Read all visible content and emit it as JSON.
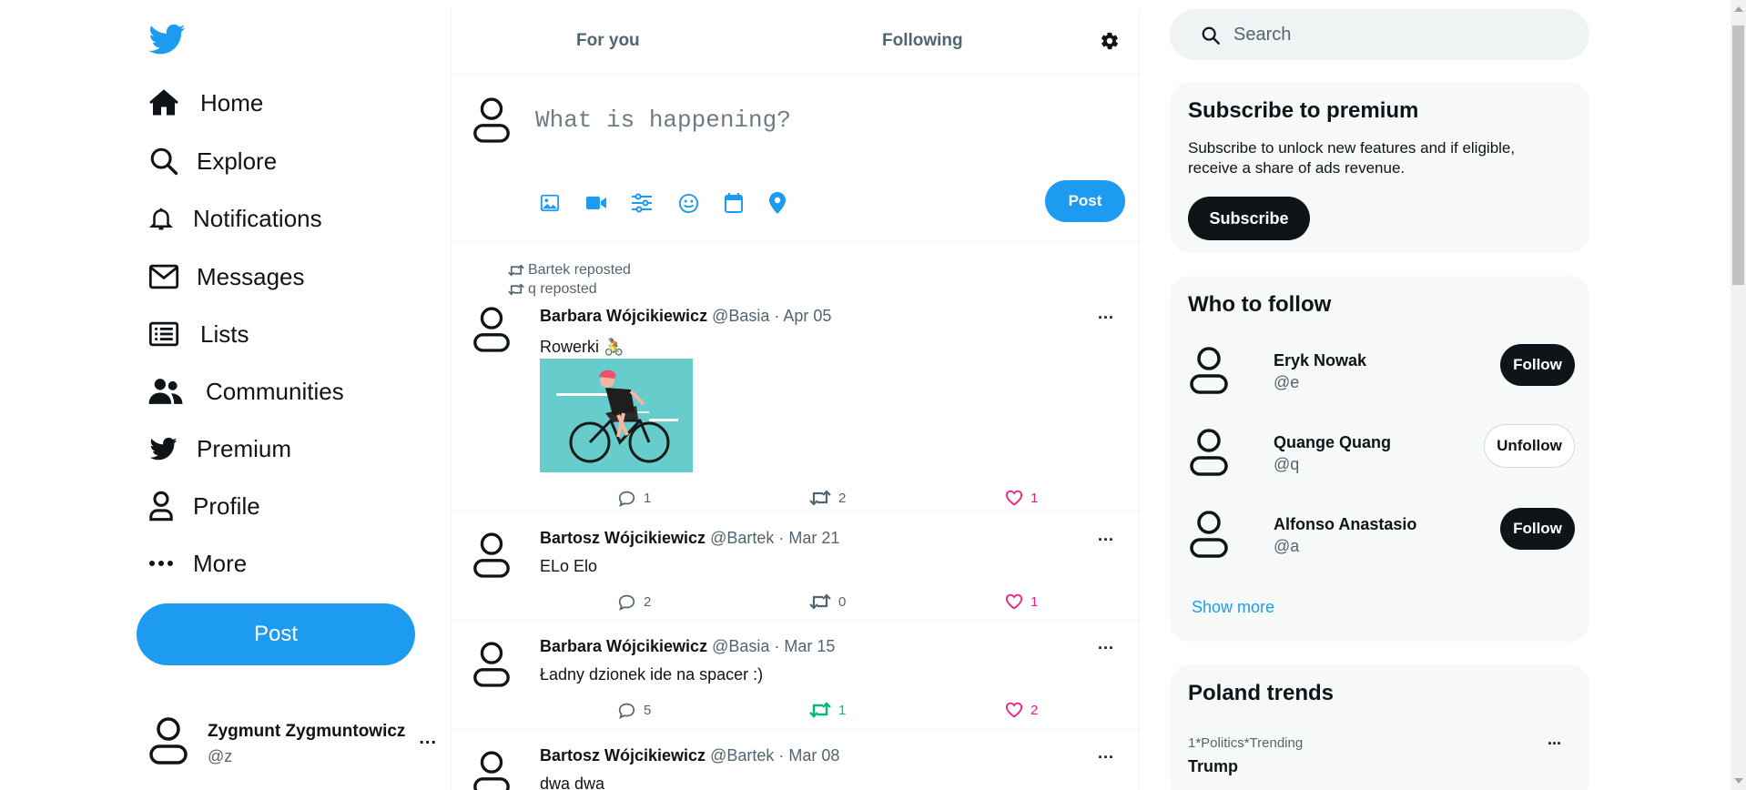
{
  "nav": {
    "items": [
      {
        "label": "Home",
        "icon": "home-icon"
      },
      {
        "label": "Explore",
        "icon": "search-icon"
      },
      {
        "label": "Notifications",
        "icon": "bell-icon"
      },
      {
        "label": "Messages",
        "icon": "envelope-icon"
      },
      {
        "label": "Lists",
        "icon": "list-icon"
      },
      {
        "label": "Communities",
        "icon": "people-icon"
      },
      {
        "label": "Premium",
        "icon": "twitter-bird-icon"
      },
      {
        "label": "Profile",
        "icon": "person-icon"
      },
      {
        "label": "More",
        "icon": "ellipsis-icon"
      }
    ],
    "post_label": "Post"
  },
  "account": {
    "name": "Zygmunt Zygmuntowicz",
    "handle": "@z",
    "more": "..."
  },
  "tabs": {
    "for_you": "For you",
    "following": "Following"
  },
  "composer": {
    "placeholder": "What is happening?",
    "post_label": "Post"
  },
  "tweets": [
    {
      "reposts_by": [
        "Bartek reposted",
        "q reposted"
      ],
      "name": "Barbara Wójcikiewicz",
      "meta": "@Basia · Apr 05",
      "text": "Rowerki 🚴",
      "has_image": true,
      "replies": "1",
      "retweets": "2",
      "likes": "1",
      "retweeted": false
    },
    {
      "name": "Bartosz Wójcikiewicz",
      "meta": "@Bartek · Mar 21",
      "text": "ELo Elo",
      "replies": "2",
      "retweets": "0",
      "likes": "1",
      "retweeted": false
    },
    {
      "name": "Barbara Wójcikiewicz",
      "meta": "@Basia · Mar 15",
      "text": "Ładny dzionek ide na spacer :)",
      "replies": "5",
      "retweets": "1",
      "likes": "2",
      "retweeted": true
    },
    {
      "name": "Bartosz Wójcikiewicz",
      "meta": "@Bartek · Mar 08",
      "text": "dwa dwa"
    }
  ],
  "tweet_more": "...",
  "search": {
    "placeholder": "Search"
  },
  "premium": {
    "title": "Subscribe to premium",
    "description": "Subscribe to unlock new features and if eligible, receive a share of ads revenue.",
    "button": "Subscribe"
  },
  "who_to_follow": {
    "title": "Who to follow",
    "users": [
      {
        "name": "Eryk Nowak",
        "handle": "@e",
        "button": "Follow"
      },
      {
        "name": "Quange Quang",
        "handle": "@q",
        "button": "Unfollow"
      },
      {
        "name": "Alfonso Anastasio",
        "handle": "@a",
        "button": "Follow"
      }
    ],
    "show_more": "Show more"
  },
  "trends": {
    "title": "Poland trends",
    "items": [
      {
        "meta": "1*Politics*Trending",
        "name": "Trump",
        "more": "..."
      }
    ]
  },
  "colors": {
    "accent": "#1d9bf0",
    "like": "#f91880",
    "retweet_active": "#00ba7c",
    "text": "#0f1419",
    "muted": "#536471"
  }
}
